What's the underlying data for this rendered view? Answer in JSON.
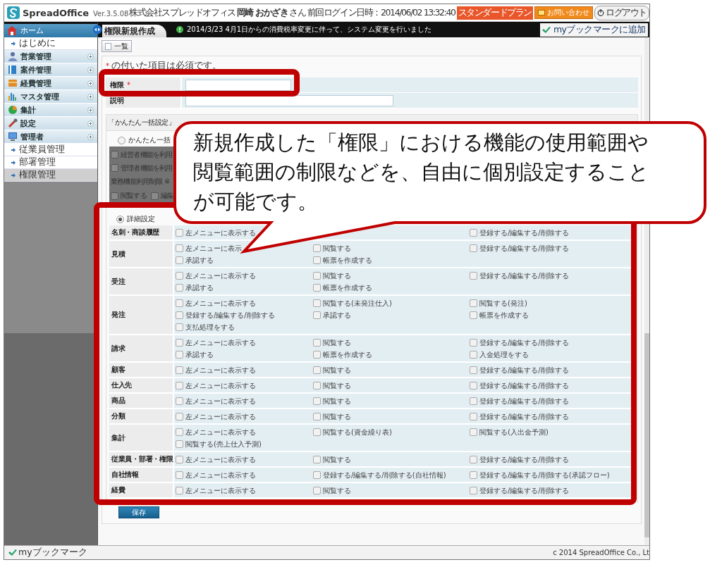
{
  "header": {
    "logo": "SpreadOffice",
    "version": "Ver.3.5.08",
    "company": "株式会社スプレッドオフィス",
    "user_name": "岡崎 おかざき",
    "honorific": "さん",
    "last_login": "前回ログイン日時：2014/06/02 13:32:40",
    "plan_badge": "スタンダードプラン",
    "contact_button": "お問い合わせ",
    "logout_button": "ログアウト"
  },
  "sidebar": {
    "items": [
      {
        "label": "ホーム",
        "kind": "home",
        "children": [
          {
            "label": "はじめに",
            "selected": false
          }
        ]
      },
      {
        "label": "営業管理",
        "kind": "group"
      },
      {
        "label": "案件管理",
        "kind": "group"
      },
      {
        "label": "経費管理",
        "kind": "group"
      },
      {
        "label": "マスタ管理",
        "kind": "group"
      },
      {
        "label": "集計",
        "kind": "group"
      },
      {
        "label": "設定",
        "kind": "group"
      },
      {
        "label": "管理者",
        "kind": "group",
        "children": [
          {
            "label": "従業員管理",
            "selected": false
          },
          {
            "label": "部署管理",
            "selected": false
          },
          {
            "label": "権限管理",
            "selected": true
          }
        ]
      }
    ]
  },
  "navbar": {
    "tab": "権限新規作成",
    "news": "2014/3/23 4月1日からの消費税率変更に伴って、システム変更を行いました",
    "bookmark_link": "myブックマークに追加"
  },
  "toolbar": {
    "list_button": "一覧"
  },
  "form": {
    "required_mark": "*",
    "required_note": "の付いた項目は必須です。",
    "fields": [
      {
        "label": "権限",
        "mark": "*"
      },
      {
        "label": "説明"
      }
    ]
  },
  "settings": {
    "header": "「かんたん一括設定」",
    "quick": {
      "label": "かんたん一括",
      "selected": false,
      "options": [
        {
          "label": "経営者機能を利用",
          "checked": false
        },
        {
          "label": "管理者機能を利用",
          "checked": false
        }
      ],
      "restriction_label": "業務機能利用制限 ※",
      "restriction_options": [
        {
          "label": "閲覧する",
          "checked": false
        },
        {
          "label": "編集",
          "checked": false
        }
      ]
    },
    "detail": {
      "label": "詳細設定",
      "selected": true,
      "rows": [
        {
          "label": "名刺・商談履歴",
          "cells": [
            {
              "options": [
                {
                  "label": "左メニューに表示する",
                  "checked": false
                }
              ]
            },
            {},
            {
              "options": [
                {
                  "label": "登録する/編集する/削除する",
                  "checked": false
                }
              ]
            }
          ]
        },
        {
          "label": "見積",
          "cells": [
            {
              "options": [
                {
                  "label": "左メニューに表示",
                  "checked": false
                },
                {
                  "label": "承認する",
                  "checked": false
                }
              ]
            },
            {
              "options": [
                {
                  "label": "閲覧する",
                  "checked": false
                },
                {
                  "label": "帳票を作成する",
                  "checked": false
                }
              ]
            },
            {
              "options": [
                {
                  "label": "登録する/編集する/削除する",
                  "checked": false
                }
              ]
            }
          ]
        },
        {
          "label": "受注",
          "cells": [
            {
              "options": [
                {
                  "label": "左メニューに表示する",
                  "checked": false
                },
                {
                  "label": "承認する",
                  "checked": false
                }
              ]
            },
            {
              "options": [
                {
                  "label": "閲覧する",
                  "checked": false
                },
                {
                  "label": "帳票を作成する",
                  "checked": false
                }
              ]
            },
            {
              "options": [
                {
                  "label": "登録する/編集する/削除する",
                  "checked": false
                }
              ]
            }
          ]
        },
        {
          "label": "発注",
          "cells": [
            {
              "options": [
                {
                  "label": "左メニューに表示する",
                  "checked": false
                },
                {
                  "label": "登録する/編集する/削除する",
                  "checked": false
                },
                {
                  "label": "支払処理をする",
                  "checked": false
                }
              ]
            },
            {
              "options": [
                {
                  "label": "閲覧する(未発注仕入)",
                  "checked": false
                },
                {
                  "label": "承認する",
                  "checked": false
                }
              ]
            },
            {
              "options": [
                {
                  "label": "閲覧する(発注)",
                  "checked": false
                },
                {
                  "label": "帳票を作成する",
                  "checked": false
                }
              ]
            }
          ]
        },
        {
          "label": "請求",
          "cells": [
            {
              "options": [
                {
                  "label": "左メニューに表示する",
                  "checked": false
                },
                {
                  "label": "承認する",
                  "checked": false
                }
              ]
            },
            {
              "options": [
                {
                  "label": "閲覧する",
                  "checked": false
                },
                {
                  "label": "帳票を作成する",
                  "checked": false
                }
              ]
            },
            {
              "options": [
                {
                  "label": "登録する/編集する/削除する",
                  "checked": false
                },
                {
                  "label": "入金処理をする",
                  "checked": false
                }
              ]
            }
          ]
        },
        {
          "label": "顧客",
          "cells": [
            {
              "options": [
                {
                  "label": "左メニューに表示する",
                  "checked": false
                }
              ]
            },
            {
              "options": [
                {
                  "label": "閲覧する",
                  "checked": false
                }
              ]
            },
            {
              "options": [
                {
                  "label": "登録する/編集する/削除する",
                  "checked": false
                }
              ]
            }
          ]
        },
        {
          "label": "仕入先",
          "cells": [
            {
              "options": [
                {
                  "label": "左メニューに表示する",
                  "checked": false
                }
              ]
            },
            {
              "options": [
                {
                  "label": "閲覧する",
                  "checked": false
                }
              ]
            },
            {
              "options": [
                {
                  "label": "登録する/編集する/削除する",
                  "checked": false
                }
              ]
            }
          ]
        },
        {
          "label": "商品",
          "cells": [
            {
              "options": [
                {
                  "label": "左メニューに表示する",
                  "checked": false
                }
              ]
            },
            {
              "options": [
                {
                  "label": "閲覧する",
                  "checked": false
                }
              ]
            },
            {
              "options": [
                {
                  "label": "登録する/編集する/削除する",
                  "checked": false
                }
              ]
            }
          ]
        },
        {
          "label": "分類",
          "cells": [
            {
              "options": [
                {
                  "label": "左メニューに表示する",
                  "checked": false
                }
              ]
            },
            {
              "options": [
                {
                  "label": "閲覧する",
                  "checked": false
                }
              ]
            },
            {
              "options": [
                {
                  "label": "登録する/編集する/削除する",
                  "checked": false
                }
              ]
            }
          ]
        },
        {
          "label": "集計",
          "cells": [
            {
              "options": [
                {
                  "label": "左メニューに表示する",
                  "checked": false
                },
                {
                  "label": "閲覧する(売上仕入予測)",
                  "checked": false
                }
              ]
            },
            {
              "options": [
                {
                  "label": "閲覧する(資金繰り表)",
                  "checked": false
                }
              ]
            },
            {
              "options": [
                {
                  "label": "閲覧する(入出金予測)",
                  "checked": false
                }
              ]
            }
          ]
        },
        {
          "label": "従業員・部署・権限",
          "cells": [
            {
              "options": [
                {
                  "label": "左メニューに表示する",
                  "checked": false
                }
              ]
            },
            {
              "options": [
                {
                  "label": "閲覧する",
                  "checked": false
                }
              ]
            },
            {
              "options": [
                {
                  "label": "登録する/編集する/削除する",
                  "checked": false
                }
              ]
            }
          ]
        },
        {
          "label": "自社情報",
          "cells": [
            {
              "options": [
                {
                  "label": "左メニューに表示する",
                  "checked": false
                }
              ]
            },
            {
              "options": [
                {
                  "label": "登録する/編集する/削除する(自社情報)",
                  "checked": false
                }
              ]
            },
            {
              "options": [
                {
                  "label": "登録する/編集する/削除する(承認フロー)",
                  "checked": false
                }
              ]
            }
          ]
        },
        {
          "label": "経費",
          "cells": [
            {
              "options": [
                {
                  "label": "左メニューに表示する",
                  "checked": false
                }
              ]
            },
            {
              "options": [
                {
                  "label": "閲覧する",
                  "checked": false
                }
              ]
            },
            {
              "options": [
                {
                  "label": "登録する/編集する/削除する",
                  "checked": false
                }
              ]
            }
          ]
        }
      ]
    }
  },
  "save_button": "保存",
  "footer": {
    "bookmark": "myブックマーク",
    "copyright": "c 2014 SpreadOffice Co., Lt"
  },
  "callout": {
    "text": "新規作成した「権限」における機能の使用範囲や閲覧範囲の制限などを、自由に個別設定することが可能です。"
  }
}
